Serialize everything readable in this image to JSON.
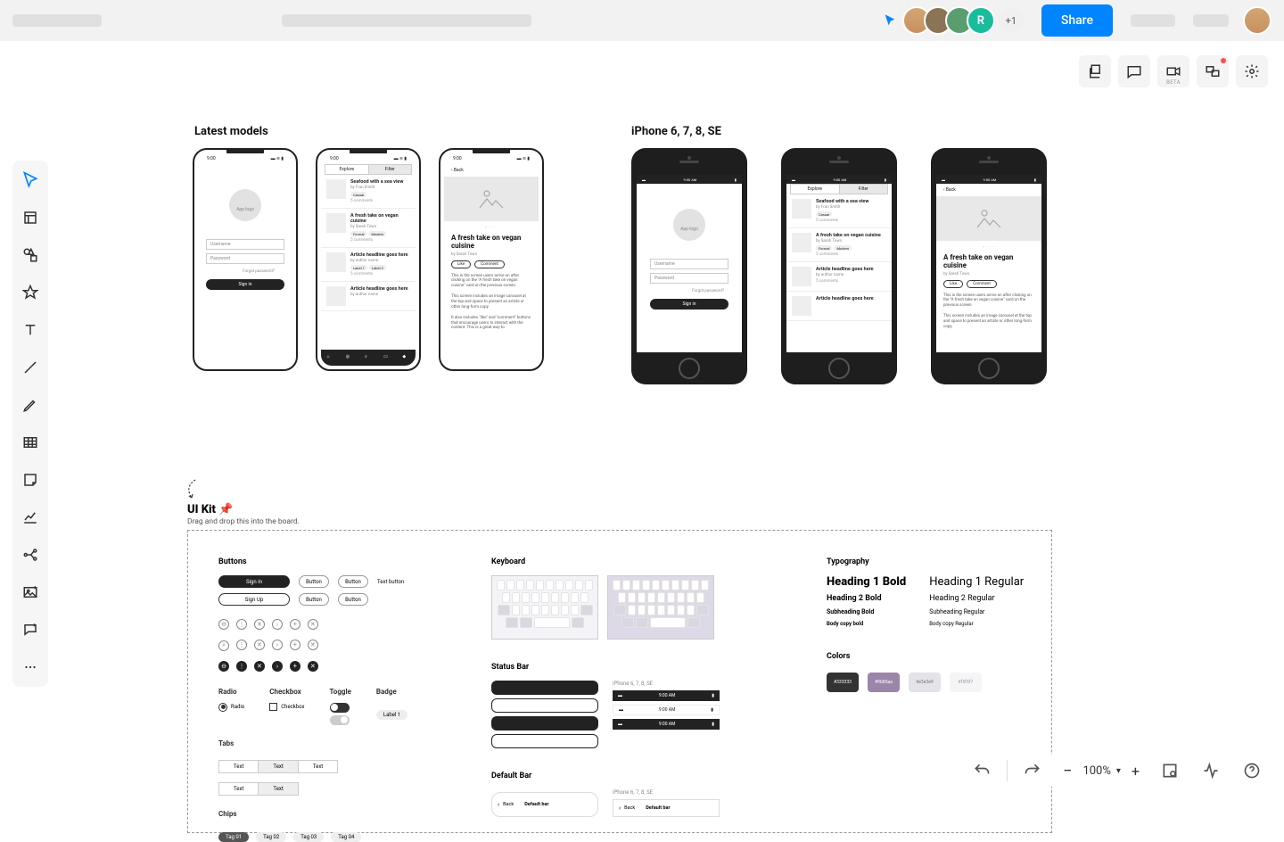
{
  "header": {
    "share_label": "Share",
    "avatar_count": "+1",
    "avatar_4_initial": "R"
  },
  "canvas_tools": {
    "beta_label": "BETA"
  },
  "sections": {
    "latest_models": "Latest models",
    "iphone_legacy": "iPhone 6, 7, 8, SE"
  },
  "login": {
    "app_logo": "App logo",
    "username": "Username",
    "password": "Password",
    "forgot": "Forgot password?",
    "signin": "Sign in"
  },
  "feed": {
    "tab_explore": "Explore",
    "tab_filter": "Filter",
    "items": [
      {
        "title": "Seafood with a sea view",
        "author": "by Fran Smith",
        "tags": [
          "Casual"
        ],
        "comments": "5 comments"
      },
      {
        "title": "A fresh take on vegan cuisine",
        "author": "by Sarah Town",
        "tags": [
          "Formal",
          "Modern"
        ],
        "comments": "5 comments"
      },
      {
        "title": "Article headline goes here",
        "author": "by author name",
        "tags": [
          "Label 1",
          "Label 2"
        ],
        "comments": "5 comments"
      },
      {
        "title": "Article headline goes here",
        "author": "by author name",
        "tags": [],
        "comments": ""
      }
    ]
  },
  "article": {
    "back": "‹  Back",
    "title": "A fresh take on vegan cuisine",
    "byline": "by Sarah Town",
    "like": "Like",
    "comment": "Comment",
    "para1": "This is the screen users arrive on after clicking on the \"A fresh take on vegan cuisine\" card on the previous screen.",
    "para2": "This screen includes an image carousel at the top and space to present an article or other long-form copy.",
    "para3": "It also includes \"like\" and \"comment\" buttons that encourage users to interact with the content. This is a great way to"
  },
  "uikit": {
    "title": "UI Kit 📌",
    "sub": "Drag and drop this into the board.",
    "buttons_label": "Buttons",
    "signin": "Sign in",
    "signup": "Sign Up",
    "button": "Button",
    "text_button": "Text button",
    "radio_label": "Radio",
    "radio_item": "Radio",
    "checkbox_label": "Checkbox",
    "checkbox_item": "Checkbox",
    "toggle_label": "Toggle",
    "badge_label": "Badge",
    "badge_item": "Label 1",
    "tabs_label": "Tabs",
    "tab_text": "Text",
    "chips_label": "Chips",
    "chips": [
      "Tag 01",
      "Tag 02",
      "Tag 03",
      "Tag 04"
    ],
    "keyboard_label": "Keyboard",
    "statusbar_label": "Status Bar",
    "sb_legacy": "iPhone 6, 7, 8, SE",
    "sb_time": "9:00 AM",
    "defaultbar_label": "Default Bar",
    "db_back": "Back",
    "db_title": "Default bar",
    "typo_label": "Typography",
    "h1_bold": "Heading 1 Bold",
    "h1_reg": "Heading 1 Regular",
    "h2_bold": "Heading 2 Bold",
    "h2_reg": "Heading 2 Regular",
    "sub_bold": "Subheading Bold",
    "sub_reg": "Subheading Regular",
    "body_bold": "Body copy bold",
    "body_reg": "Body copy Regular",
    "colors_label": "Colors",
    "swatches": [
      "#333333",
      "#9b85aa",
      "#e3e3e9",
      "#f5f5f7"
    ]
  },
  "status_bar_time": "9:00",
  "zoom": {
    "level": "100%"
  }
}
